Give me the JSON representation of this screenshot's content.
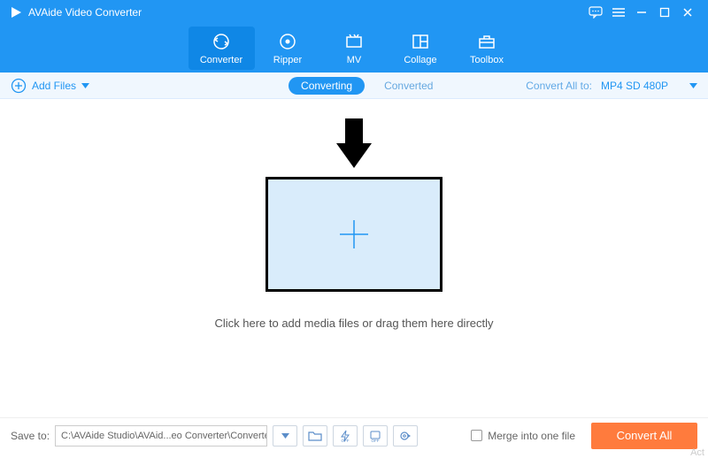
{
  "app": {
    "title": "AVAide Video Converter"
  },
  "nav": {
    "converter": "Converter",
    "ripper": "Ripper",
    "mv": "MV",
    "collage": "Collage",
    "toolbox": "Toolbox"
  },
  "subbar": {
    "add_files": "Add Files",
    "converting": "Converting",
    "converted": "Converted",
    "convert_all_to": "Convert All to:",
    "format": "MP4 SD 480P"
  },
  "main": {
    "hint": "Click here to add media files or drag them here directly"
  },
  "footer": {
    "save_to_label": "Save to:",
    "save_path": "C:\\AVAide Studio\\AVAid...eo Converter\\Converted",
    "merge_label": "Merge into one file",
    "convert_all": "Convert All",
    "watermark": "Act"
  }
}
